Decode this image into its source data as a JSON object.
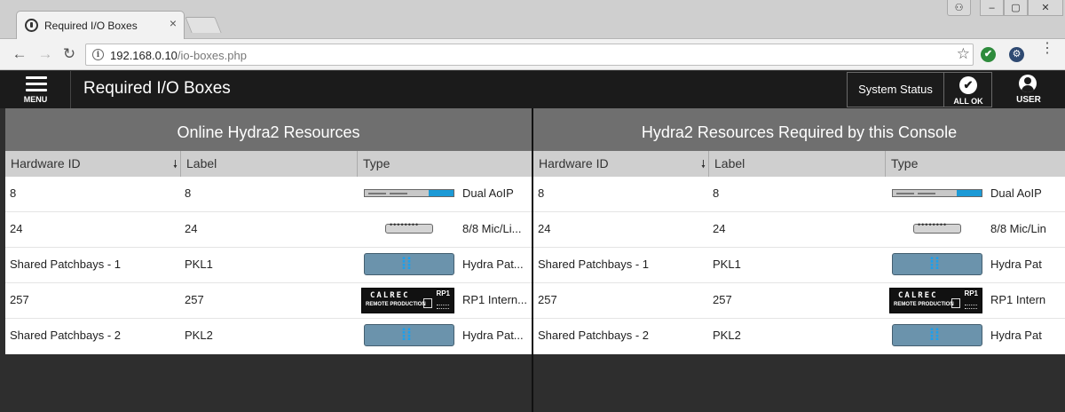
{
  "browser": {
    "tab_title": "Required I/O Boxes",
    "tab_close": "×",
    "url_host": "192.168.0.10",
    "url_path": "/io-boxes.php",
    "info_glyph": "i",
    "nav": {
      "back": "←",
      "forward": "→",
      "reload": "↻"
    },
    "star": "☆",
    "window": {
      "profile": "⚇",
      "minimize": "–",
      "maximize": "▢",
      "close": "✕"
    },
    "ext_check": "✔",
    "ext_gear": "⚙",
    "menu_dots": "⋮"
  },
  "app": {
    "menu_label": "MENU",
    "page_title": "Required I/O Boxes",
    "system_status_label": "System Status",
    "all_ok_icon": "✔",
    "all_ok_label": "ALL OK",
    "user_label": "USER"
  },
  "panels": {
    "left": {
      "title": "Online Hydra2 Resources",
      "columns": {
        "hardware_id": "Hardware ID",
        "label": "Label",
        "type": "Type"
      },
      "rows": [
        {
          "hardware_id": "8",
          "label": "8",
          "type": "Dual AoIP",
          "device": "dual-aoip"
        },
        {
          "hardware_id": "24",
          "label": "24",
          "type": "8/8 Mic/Li...",
          "device": "mic-line-box"
        },
        {
          "hardware_id": "Shared Patchbays - 1",
          "label": "PKL1",
          "type": "Hydra Pat...",
          "device": "hydra-patchbay"
        },
        {
          "hardware_id": "257",
          "label": "257",
          "type": "RP1 Intern...",
          "device": "rp1"
        },
        {
          "hardware_id": "Shared Patchbays - 2",
          "label": "PKL2",
          "type": "Hydra Pat...",
          "device": "hydra-patchbay"
        }
      ]
    },
    "right": {
      "title": "Hydra2 Resources Required by this Console",
      "columns": {
        "hardware_id": "Hardware ID",
        "label": "Label",
        "type": "Type"
      },
      "rows": [
        {
          "hardware_id": "8",
          "label": "8",
          "type": "Dual AoIP",
          "device": "dual-aoip"
        },
        {
          "hardware_id": "24",
          "label": "24",
          "type": "8/8 Mic/Lin",
          "device": "mic-line-box"
        },
        {
          "hardware_id": "Shared Patchbays - 1",
          "label": "PKL1",
          "type": "Hydra Pat",
          "device": "hydra-patchbay"
        },
        {
          "hardware_id": "257",
          "label": "257",
          "type": "RP1 Intern",
          "device": "rp1"
        },
        {
          "hardware_id": "Shared Patchbays - 2",
          "label": "PKL2",
          "type": "Hydra Pat",
          "device": "hydra-patchbay"
        }
      ]
    }
  },
  "sort_icon": "🠗",
  "rp1_text": {
    "brand": "CALREC",
    "sub": "REMOTE PRODUCTION",
    "tag": "RP1"
  },
  "colors": {
    "header_bg": "#1b1b1b",
    "panel_title_bg": "#6f6f6f",
    "column_head_bg": "#cfcfcf",
    "accent_blue": "#1c9ad6",
    "ok_green": "#2e8b3c"
  }
}
